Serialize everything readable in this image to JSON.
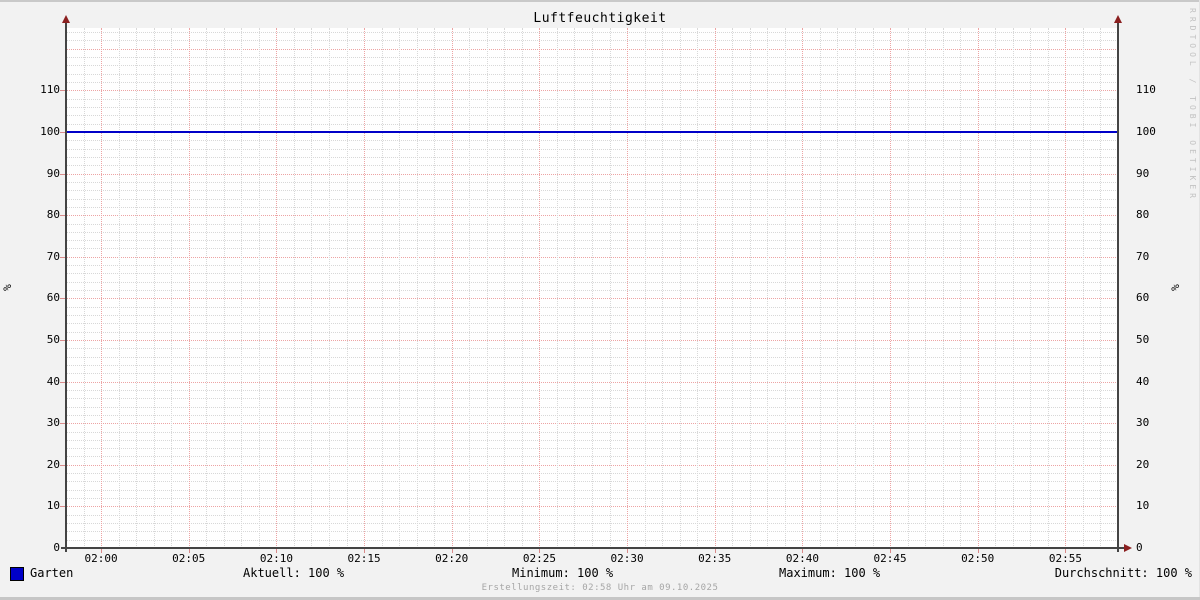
{
  "window": {
    "title": "Luftfeuchtigkeit"
  },
  "chart_data": {
    "type": "line",
    "title": "Luftfeuchtigkeit",
    "ylabel": "%",
    "ylabel_right": "%",
    "ylim": [
      0,
      125
    ],
    "y_major_step": 10,
    "y_minor_step": 2,
    "x_start": "01:58",
    "x_end": "02:58",
    "x_total_minutes": 60,
    "x_minor_step_minutes": 1,
    "x_major_step_minutes": 5,
    "x_first_major_offset_minutes": 2,
    "x_tick_labels": [
      "02:00",
      "02:05",
      "02:10",
      "02:15",
      "02:20",
      "02:25",
      "02:30",
      "02:35",
      "02:40",
      "02:45",
      "02:50",
      "02:55"
    ],
    "grid": true,
    "legend_position": "bottom",
    "series": [
      {
        "name": "Garten",
        "color": "#0000c8",
        "type": "line",
        "x": [
          "01:58",
          "02:58"
        ],
        "values": [
          100,
          100
        ],
        "stats": {
          "aktuell": "100 %",
          "minimum": "100 %",
          "maximum": "100 %",
          "durchschnitt": "100 %"
        }
      }
    ]
  },
  "legend": {
    "series_label": "Garten",
    "series_color": "#0000c8",
    "stats": [
      {
        "text": "Aktuell: 100 %"
      },
      {
        "text": "Minimum: 100 %"
      },
      {
        "text": "Maximum: 100 %"
      },
      {
        "text": "Durchschnitt: 100 %"
      }
    ]
  },
  "footer": {
    "creation_text": "Erstellungszeit: 02:58 Uhr am 09.10.2025"
  },
  "watermark": "RRDTOOL / TOBI OETIKER",
  "colors": {
    "background": "#f2f2f2",
    "canvas": "#ffffff",
    "series": "#0000c8",
    "major_grid": "#eda4a4",
    "minor_grid": "#d8d8d8",
    "axis": "#444444",
    "arrow": "#8b2020",
    "watermark_text": "#c2c2c2",
    "footer_text": "#a6a6a6"
  }
}
